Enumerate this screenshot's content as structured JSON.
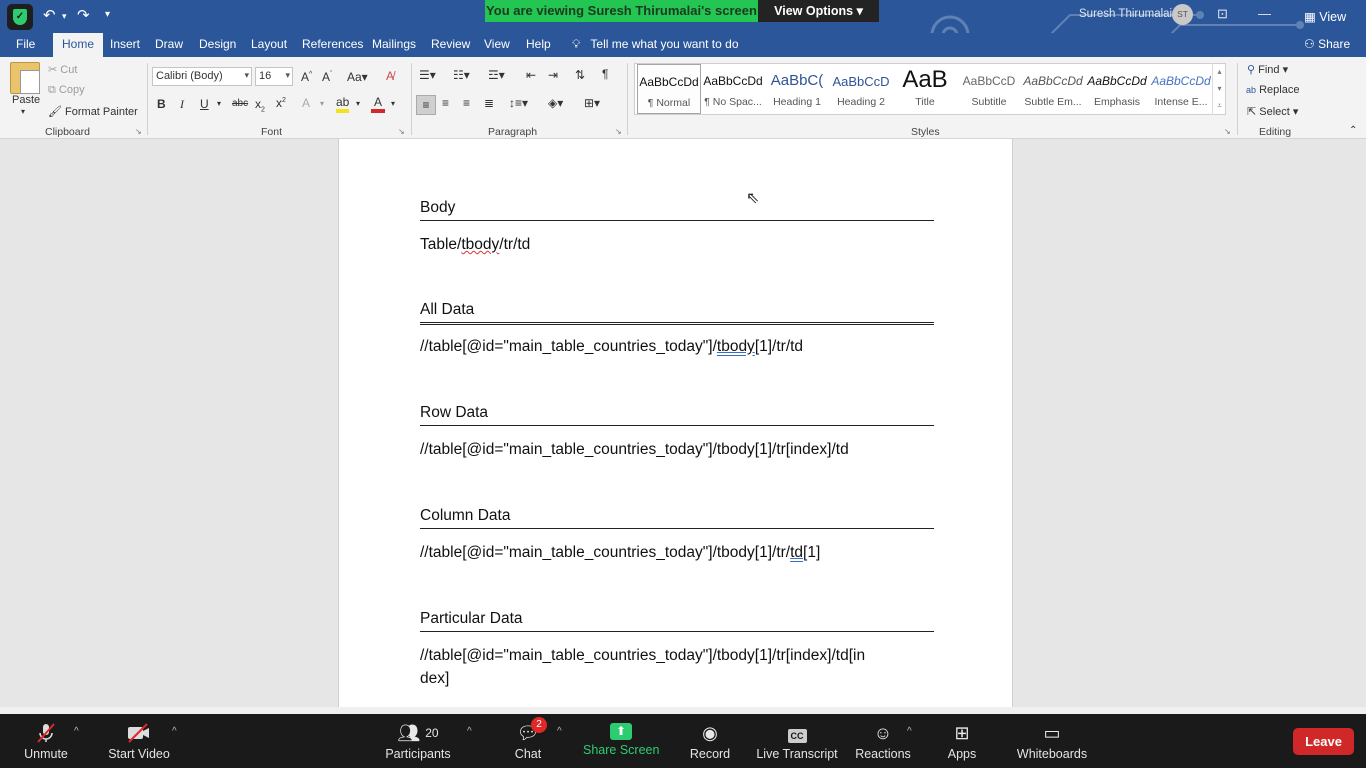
{
  "titlebar": {
    "banner": "You are viewing Suresh Thirumalai's screen",
    "view_options": "View Options",
    "user_name": "Suresh Thirumalai",
    "user_initials": "ST",
    "view_label": "View"
  },
  "menu": {
    "tabs": [
      "File",
      "Home",
      "Insert",
      "Draw",
      "Design",
      "Layout",
      "References",
      "Mailings",
      "Review",
      "View",
      "Help"
    ],
    "tell_me": "Tell me what you want to do",
    "share": "Share"
  },
  "ribbon": {
    "clipboard": {
      "paste": "Paste",
      "cut": "Cut",
      "copy": "Copy",
      "format_painter": "Format Painter",
      "label": "Clipboard"
    },
    "font": {
      "name": "Calibri (Body)",
      "size": "16",
      "label": "Font"
    },
    "paragraph": {
      "label": "Paragraph"
    },
    "styles": {
      "label": "Styles",
      "items": [
        {
          "sample": "AaBbCcDd",
          "name": "¶ Normal"
        },
        {
          "sample": "AaBbCcDd",
          "name": "¶ No Spac..."
        },
        {
          "sample": "AaBbC(",
          "name": "Heading 1"
        },
        {
          "sample": "AaBbCcD",
          "name": "Heading 2"
        },
        {
          "sample": "AaB",
          "name": "Title"
        },
        {
          "sample": "AaBbCcD",
          "name": "Subtitle"
        },
        {
          "sample": "AaBbCcDd",
          "name": "Subtle Em..."
        },
        {
          "sample": "AaBbCcDd",
          "name": "Emphasis"
        },
        {
          "sample": "AaBbCcDd",
          "name": "Intense E..."
        }
      ]
    },
    "editing": {
      "find": "Find",
      "replace": "Replace",
      "select": "Select",
      "label": "Editing"
    }
  },
  "document": {
    "sections": [
      {
        "heading": "Body",
        "text_pre": "Table/",
        "text_mark": "tbody",
        "text_post": "/tr/td"
      },
      {
        "heading": "All Data",
        "text_pre": "//table[@id=\"main_table_countries_today\"]/",
        "text_mark": "tbody",
        "text_post": "[1]/tr/td"
      },
      {
        "heading": "Row Data",
        "text": "//table[@id=\"main_table_countries_today\"]/tbody[1]/tr[index]/td"
      },
      {
        "heading": "Column Data",
        "text_pre": "//table[@id=\"main_table_countries_today\"]/tbody[1]/tr/",
        "text_mark": "td",
        "text_post": "[1]"
      },
      {
        "heading": "Particular Data",
        "text": "//table[@id=\"main_table_countries_today\"]/tbody[1]/tr[index]/td[in",
        "text2": "dex]"
      }
    ]
  },
  "zoom": {
    "unmute": "Unmute",
    "start_video": "Start Video",
    "participants": "Participants",
    "participants_count": "20",
    "chat": "Chat",
    "chat_badge": "2",
    "share_screen": "Share Screen",
    "record": "Record",
    "live_transcript": "Live Transcript",
    "cc": "CC",
    "reactions": "Reactions",
    "apps": "Apps",
    "whiteboards": "Whiteboards",
    "leave": "Leave"
  }
}
